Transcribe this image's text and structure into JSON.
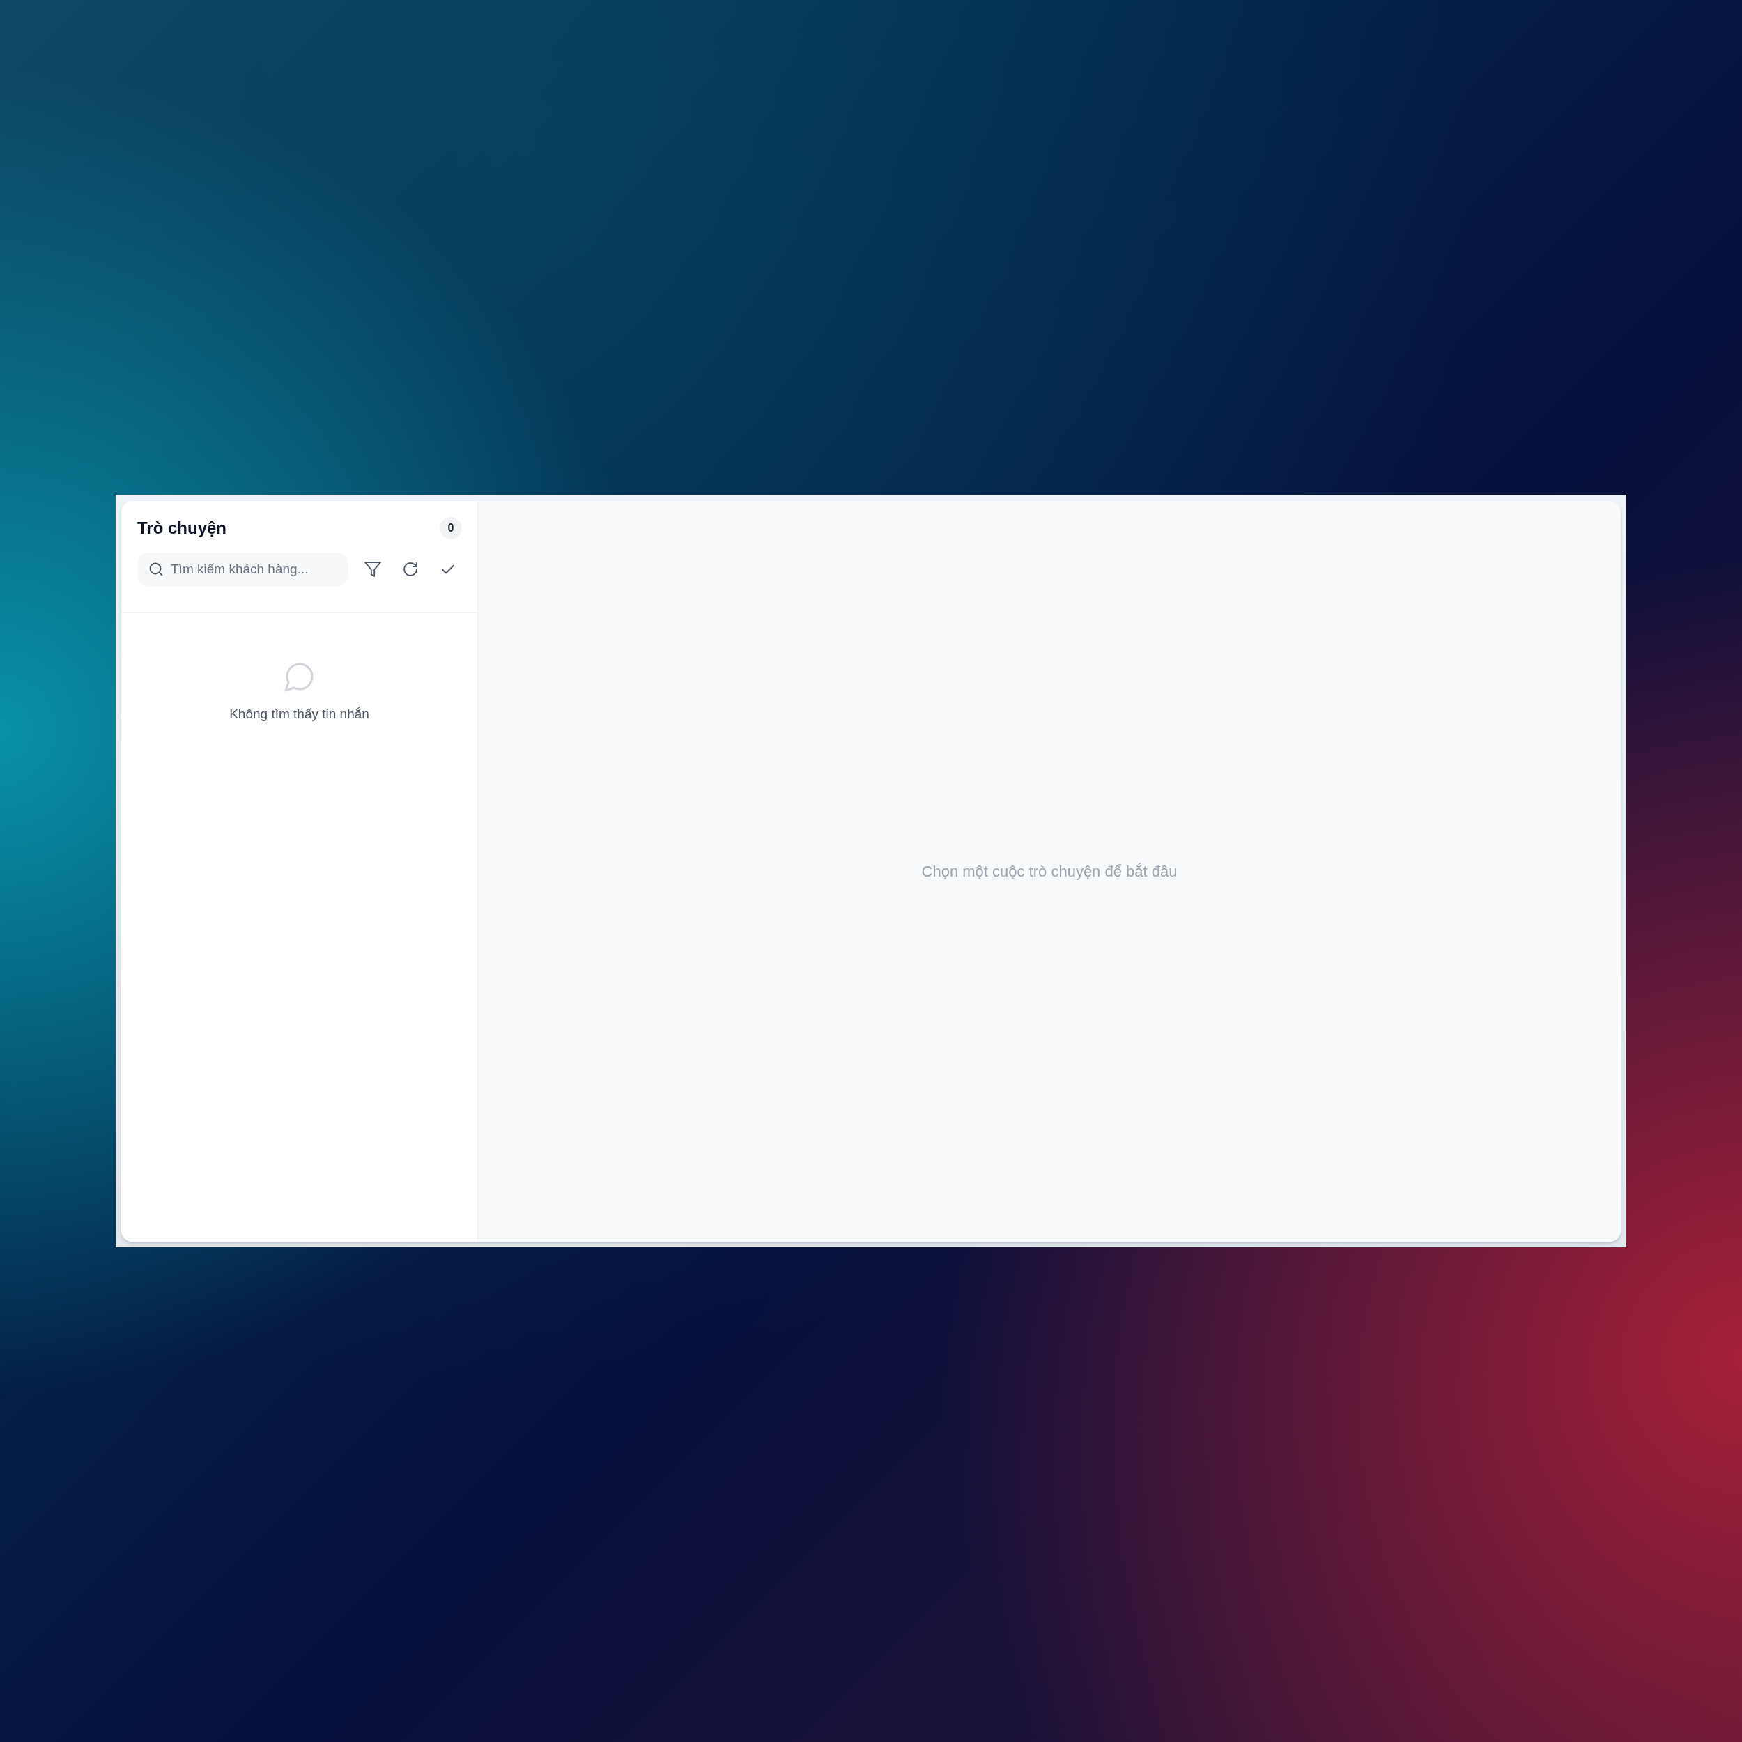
{
  "sidebar": {
    "title": "Trò chuyện",
    "count": "0",
    "search": {
      "placeholder": "Tìm kiếm khách hàng..."
    },
    "empty_state": {
      "message": "Không tìm thấy tin nhắn"
    }
  },
  "main": {
    "placeholder_message": "Chọn một cuộc trò chuyện để bắt đầu"
  }
}
